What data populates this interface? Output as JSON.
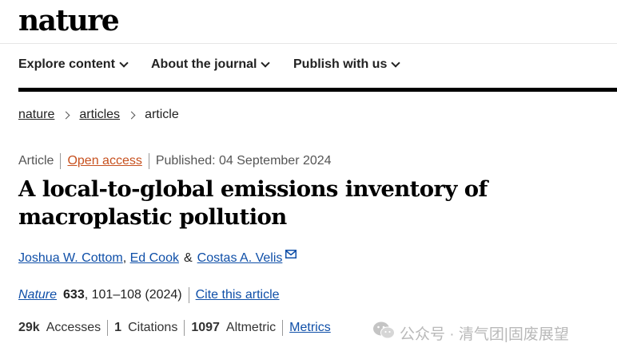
{
  "brand": {
    "logo": "nature"
  },
  "nav": {
    "items": [
      "Explore content",
      "About the journal",
      "Publish with us"
    ]
  },
  "breadcrumb": [
    "nature",
    "articles",
    "article"
  ],
  "meta": {
    "type": "Article",
    "access": "Open access",
    "published": "Published: 04 September 2024"
  },
  "title": "A local-to-global emissions inventory of macroplastic pollution",
  "authors": {
    "a1": "Joshua W. Cottom",
    "a2": "Ed Cook",
    "amp": "&",
    "a3": "Costas A. Velis"
  },
  "citation": {
    "journal": "Nature",
    "volume": "633",
    "pages": ", 101–108 (2024)",
    "cite_link": "Cite this article"
  },
  "metrics": {
    "accesses_value": "29k",
    "accesses_label": "Accesses",
    "citations_value": "1",
    "citations_label": "Citations",
    "altmetric_value": "1097",
    "altmetric_label": "Altmetric",
    "metrics_link": "Metrics"
  },
  "watermark": {
    "text": "公众号 · 清气团|固废展望",
    "icon": "wechat-icon"
  },
  "colors": {
    "open_access": "#c7511f",
    "link": "#0f4fa8",
    "rule": "#000000"
  }
}
